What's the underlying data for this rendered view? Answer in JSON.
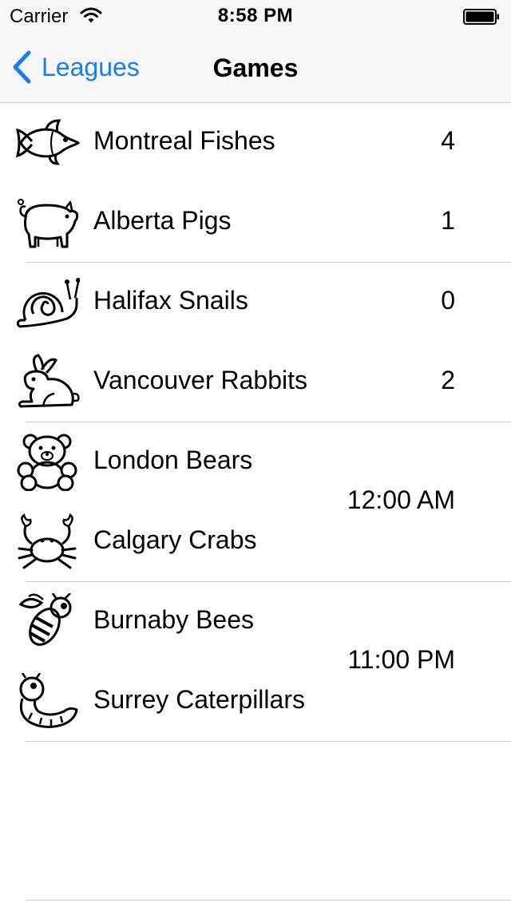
{
  "status_bar": {
    "carrier": "Carrier",
    "time": "8:58 PM"
  },
  "nav": {
    "back_label": "Leagues",
    "title": "Games"
  },
  "colors": {
    "accent": "#1b7cf5",
    "separator": "#c8c7cc",
    "bar_background": "#f7f7f7"
  },
  "games": [
    {
      "home": {
        "name": "Montreal Fishes",
        "icon": "fish-icon",
        "score": "4"
      },
      "away": {
        "name": "Alberta Pigs",
        "icon": "pig-icon",
        "score": "1"
      }
    },
    {
      "home": {
        "name": "Halifax Snails",
        "icon": "snail-icon",
        "score": "0"
      },
      "away": {
        "name": "Vancouver Rabbits",
        "icon": "rabbit-icon",
        "score": "2"
      }
    },
    {
      "home": {
        "name": "London Bears",
        "icon": "bear-icon"
      },
      "away": {
        "name": "Calgary Crabs",
        "icon": "crab-icon"
      },
      "time": "12:00 AM"
    },
    {
      "home": {
        "name": "Burnaby Bees",
        "icon": "bee-icon"
      },
      "away": {
        "name": "Surrey Caterpillars",
        "icon": "caterpillar-icon"
      },
      "time": "11:00 PM"
    }
  ]
}
